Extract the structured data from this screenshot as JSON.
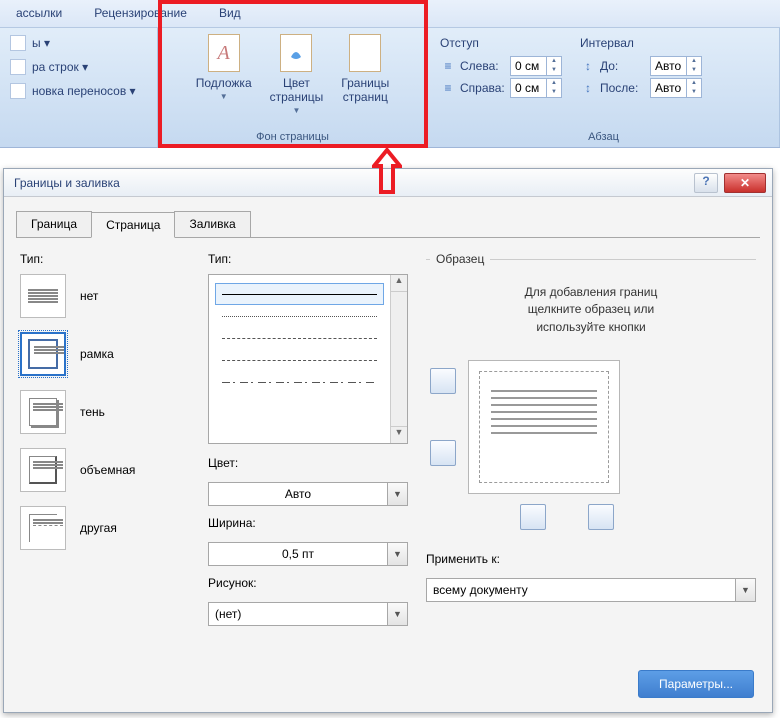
{
  "ribbon_tabs": [
    "ассылки",
    "Рецензирование",
    "Вид"
  ],
  "group_fonts": {
    "btn1": "ы ▾",
    "btn2": "ра строк ▾",
    "btn3": "новка переносов ▾"
  },
  "page_bg": {
    "watermark": "Подложка",
    "color": "Цвет\nстраницы",
    "borders": "Границы\nстраниц",
    "title": "Фон страницы"
  },
  "indent": {
    "title": "Отступ",
    "left_lbl": "Слева:",
    "right_lbl": "Справа:",
    "left_val": "0 см",
    "right_val": "0 см"
  },
  "spacing": {
    "title": "Интервал",
    "before_lbl": "До:",
    "after_lbl": "После:",
    "before_val": "Авто",
    "after_val": "Авто"
  },
  "paragraph_title": "Абзац",
  "dialog": {
    "title": "Границы и заливка",
    "tabs": [
      "Граница",
      "Страница",
      "Заливка"
    ],
    "type_lbl": "Тип:",
    "types": [
      "нет",
      "рамка",
      "тень",
      "объемная",
      "другая"
    ],
    "style_lbl": "Тип:",
    "color_lbl": "Цвет:",
    "color_val": "Авто",
    "width_lbl": "Ширина:",
    "width_val": "0,5 пт",
    "art_lbl": "Рисунок:",
    "art_val": "(нет)",
    "sample_lbl": "Образец",
    "sample_text": "Для добавления границ\nщелкните образец или\nиспользуйте кнопки",
    "apply_lbl": "Применить к:",
    "apply_val": "всему документу",
    "params_btn": "Параметры..."
  }
}
